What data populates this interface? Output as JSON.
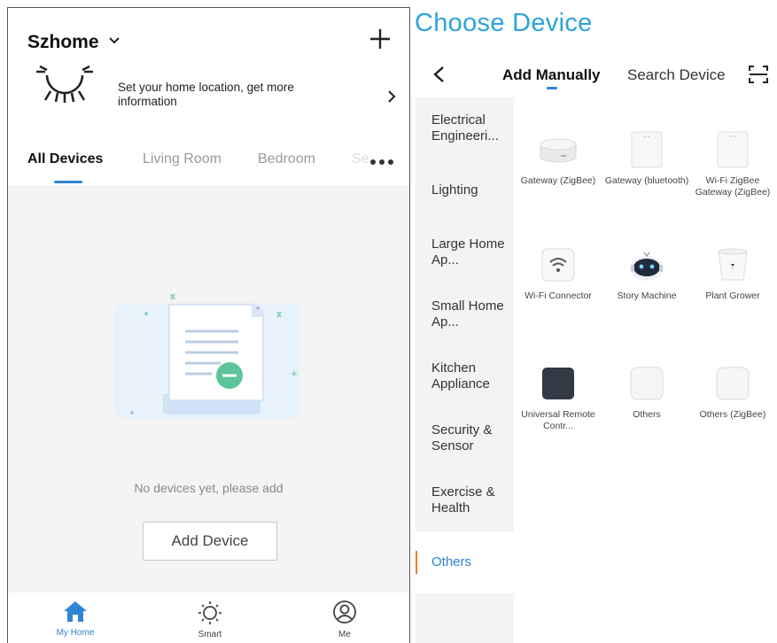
{
  "left": {
    "home_name": "Szhome",
    "location_prompt": "Set your home location, get more information",
    "tabs": [
      "All Devices",
      "Living Room",
      "Bedroom",
      "Se"
    ],
    "empty_text": "No devices yet, please add",
    "add_device_label": "Add Device",
    "nav": [
      "My Home",
      "Smart",
      "Me"
    ]
  },
  "right": {
    "title": "Choose Device",
    "tabs": [
      "Add Manually",
      "Search Device"
    ],
    "categories": [
      "Electrical Engineeri...",
      "Lighting",
      "Large Home Ap...",
      "Small Home Ap...",
      "Kitchen Appliance",
      "Security & Sensor",
      "Exercise & Health",
      "Others"
    ],
    "devices": [
      {
        "label": "Gateway (ZigBee)",
        "icon": "gateway-zigbee-icon"
      },
      {
        "label": "Gateway (bluetooth)",
        "icon": "gateway-bluetooth-icon"
      },
      {
        "label": "Wi-Fi ZigBee Gateway (ZigBee)",
        "icon": "wifi-zigbee-gateway-icon"
      },
      {
        "label": "Wi-Fi Connector",
        "icon": "wifi-connector-icon"
      },
      {
        "label": "Story Machine",
        "icon": "robot-icon"
      },
      {
        "label": "Plant Grower",
        "icon": "plant-pot-icon"
      },
      {
        "label": "Universal Remote Contr...",
        "icon": "remote-hub-icon"
      },
      {
        "label": "Others",
        "icon": "generic-device-icon"
      },
      {
        "label": "Others (ZigBee)",
        "icon": "generic-zigbee-device-icon"
      }
    ]
  },
  "colors": {
    "accent_blue": "#2f86d6",
    "title_blue": "#2ba3dd",
    "active_indicator": "#ef7c2c"
  }
}
